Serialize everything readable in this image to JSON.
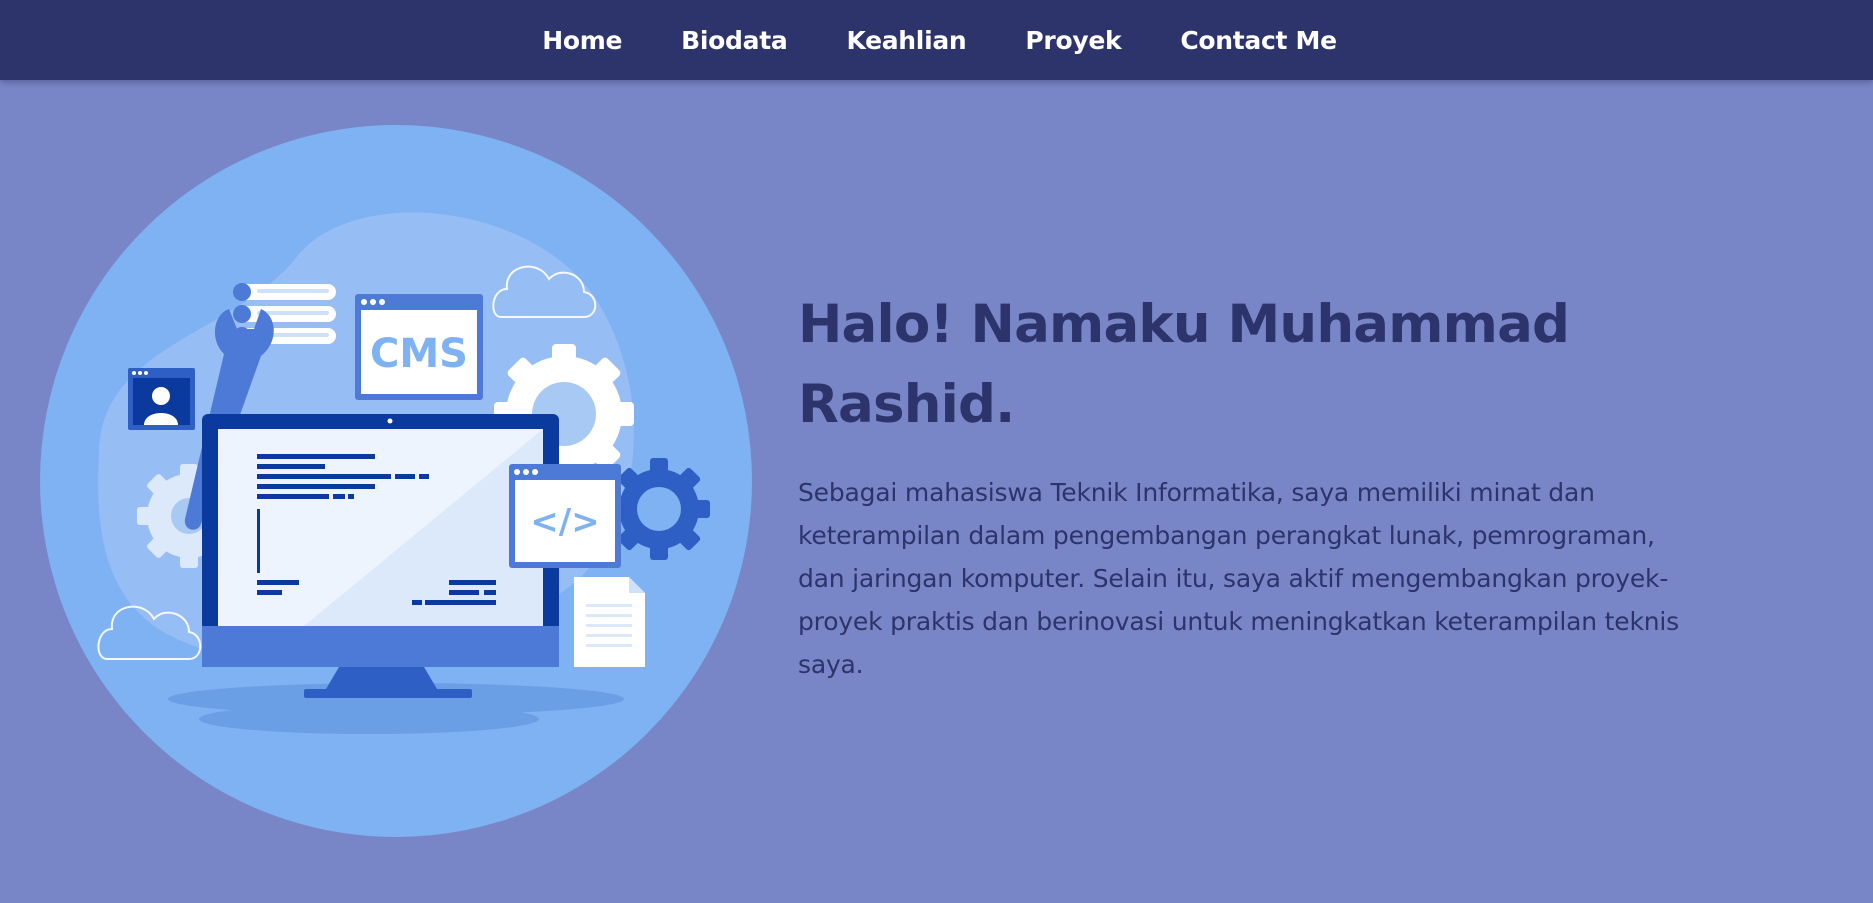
{
  "nav": {
    "items": [
      {
        "label": "Home"
      },
      {
        "label": "Biodata"
      },
      {
        "label": "Keahlian"
      },
      {
        "label": "Proyek"
      },
      {
        "label": "Contact Me"
      }
    ]
  },
  "hero": {
    "title": "Halo! Namaku Muhammad Rashid.",
    "description": "Sebagai mahasiswa Teknik Informatika, saya memiliki minat dan keterampilan dalam pengembangan perangkat lunak, pemrograman, dan jaringan komputer. Selain itu, saya aktif mengembangkan proyek-proyek praktis dan berinovasi untuk meningkatkan keterampilan teknis saya.",
    "illustration": {
      "cms_label": "CMS",
      "code_label": "</>",
      "icons": [
        "monitor-icon",
        "gear-icon",
        "wrench-icon",
        "user-profile-icon",
        "document-icon",
        "cloud-icon",
        "list-icon"
      ]
    }
  },
  "colors": {
    "page_background": "#7886c7",
    "navbar_background": "#2d336b",
    "heading_text": "#2d336b",
    "nav_text": "#ffffff",
    "illustration_circle": "#7fb2f2",
    "illustration_dark_blue": "#0b3a9e"
  }
}
